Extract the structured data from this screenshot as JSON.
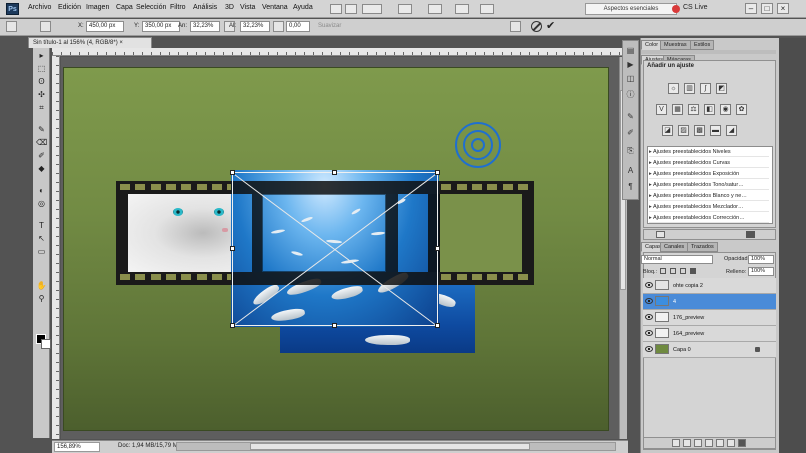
{
  "app": {
    "logo": "Ps"
  },
  "menubar": {
    "items": [
      "Archivo",
      "Edición",
      "Imagen",
      "Capa",
      "Selección",
      "Filtro",
      "Análisis",
      "3D",
      "Vista",
      "Ventana",
      "Ayuda"
    ],
    "workspace": "Aspectos esenciales",
    "cs_live": "CS Live",
    "window_buttons": [
      "–",
      "□",
      "×"
    ]
  },
  "options": {
    "x_label": "X:",
    "x_value": "450,00 px",
    "y_label": "Y:",
    "y_value": "350,00 px",
    "w_label": "An:",
    "w_value": "32,23%",
    "h_label": "Al:",
    "h_value": "32,23%",
    "angle_value": "0,00",
    "interp_label": "Suavizar"
  },
  "document": {
    "tab_title": "Sin título-1 al 156% (4, RGB/8*)",
    "tab_close": "×",
    "zoom": "156,89%",
    "doc_size": "Doc: 1,94 MB/15,79 MB"
  },
  "tools": [
    "▸",
    "⬚",
    "ʘ",
    "✣",
    "⌗",
    "✎",
    "⌫",
    "✐",
    "◆",
    "◐",
    "◎",
    "T",
    "↖",
    "▭",
    "✋",
    "⚲"
  ],
  "panels": {
    "adjustments": {
      "tabs": [
        "Ajustes",
        "Máscaras"
      ],
      "tabs_top": [
        "Color",
        "Muestras",
        "Estilos"
      ],
      "title": "Añadir un ajuste",
      "presets": [
        "Ajustes preestablecidos Niveles",
        "Ajustes preestablecidos Curvas",
        "Ajustes preestablecidos Exposición",
        "Ajustes preestablecidos Tono/satur…",
        "Ajustes preestablecidos Blanco y ne…",
        "Ajustes preestablecidos Mezclador…",
        "Ajustes preestablecidos Corrección…"
      ]
    },
    "layers": {
      "tabs": [
        "Capas",
        "Canales",
        "Trazados"
      ],
      "blend_mode": "Normal",
      "opacity_label": "Opacidad:",
      "opacity": "100%",
      "lock_label": "Bloq.:",
      "fill_label": "Relleno:",
      "fill": "100%",
      "items": [
        {
          "name": "ohte copia 2",
          "thumb": "#e4e4e4"
        },
        {
          "name": "4",
          "thumb": "#3c8ee0"
        },
        {
          "name": "176_preview",
          "thumb": "#f2f2f2"
        },
        {
          "name": "164_preview",
          "thumb": "#f2f2f2"
        },
        {
          "name": "Capa 0",
          "thumb": "#6f8a40"
        }
      ]
    }
  }
}
